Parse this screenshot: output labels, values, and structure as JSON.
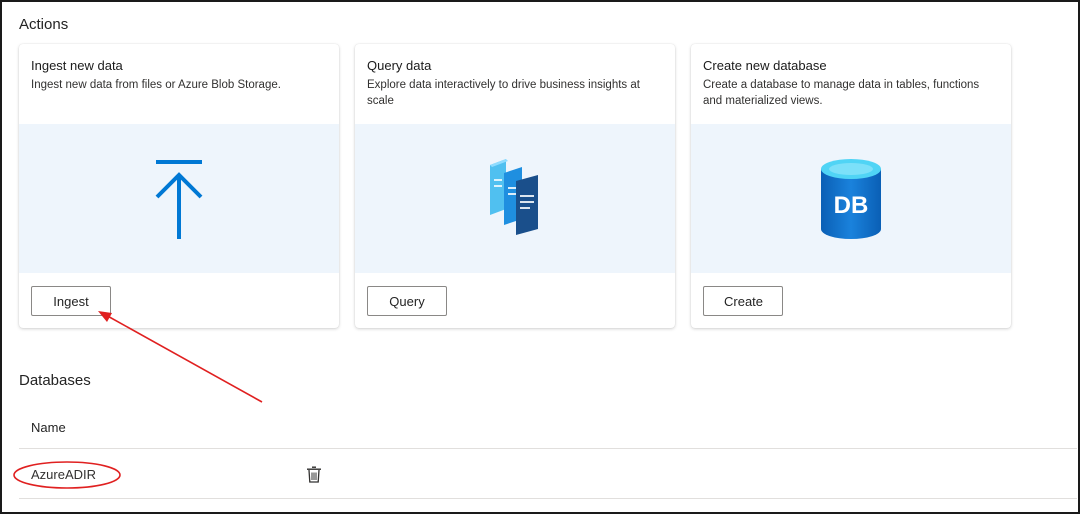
{
  "actions": {
    "title": "Actions",
    "cards": [
      {
        "title": "Ingest new data",
        "description": "Ingest new data from files or Azure Blob Storage.",
        "button_label": "Ingest",
        "icon": "upload-arrow-icon"
      },
      {
        "title": "Query data",
        "description": "Explore data interactively to drive business insights at scale",
        "button_label": "Query",
        "icon": "query-documents-icon"
      },
      {
        "title": "Create new database",
        "description": "Create a database to manage data in tables, functions and materialized views.",
        "button_label": "Create",
        "icon": "database-icon",
        "icon_text": "DB"
      }
    ]
  },
  "databases": {
    "title": "Databases",
    "columns": [
      "Name"
    ],
    "rows": [
      {
        "name": "AzureADIR"
      }
    ]
  },
  "colors": {
    "accent": "#0078d4",
    "annotation": "#e02020",
    "card_image_bg": "#eef5fc"
  }
}
